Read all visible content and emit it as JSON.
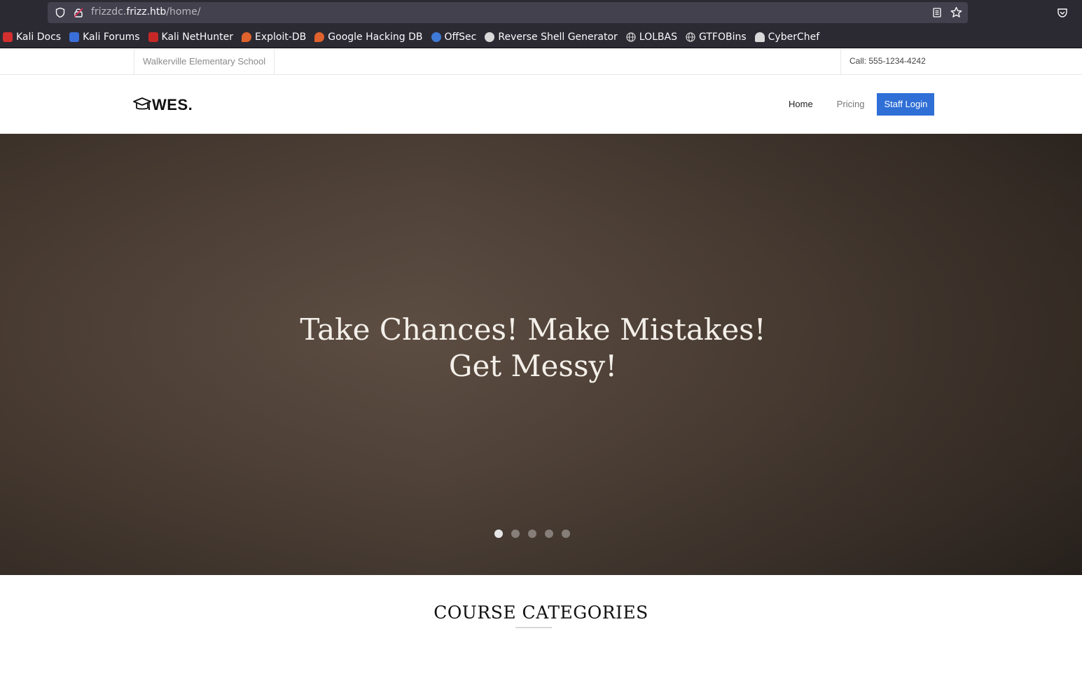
{
  "browser": {
    "url": {
      "prefix": "frizzdc.",
      "host": "frizz.htb",
      "path": "/home/"
    },
    "bookmarks": [
      {
        "label": "Kali Docs",
        "icon": "kali-docs-icon",
        "color": "#d32f2f"
      },
      {
        "label": "Kali Forums",
        "icon": "kali-forums-icon",
        "color": "#3a6ed8"
      },
      {
        "label": "Kali NetHunter",
        "icon": "kali-nethunter-icon",
        "color": "#c62828"
      },
      {
        "label": "Exploit-DB",
        "icon": "exploit-db-icon",
        "color": "#e0622c"
      },
      {
        "label": "Google Hacking DB",
        "icon": "ghdb-icon",
        "color": "#e0622c"
      },
      {
        "label": "OffSec",
        "icon": "offsec-icon",
        "color": "#3f7ad6"
      },
      {
        "label": "Reverse Shell Generator",
        "icon": "skull-icon",
        "color": "#d9d9d9"
      },
      {
        "label": "LOLBAS",
        "icon": "globe-icon",
        "color": "#d9d9d9"
      },
      {
        "label": "GTFOBins",
        "icon": "globe-icon",
        "color": "#d9d9d9"
      },
      {
        "label": "CyberChef",
        "icon": "chef-hat-icon",
        "color": "#d9d9d9"
      }
    ]
  },
  "topbar": {
    "school_name": "Walkerville Elementary School",
    "call": "Call: 555-1234-4242"
  },
  "navbar": {
    "logo_text": "WES.",
    "links": {
      "home": "Home",
      "pricing": "Pricing",
      "staff_login": "Staff Login"
    },
    "accent": "#2f6fd6"
  },
  "hero": {
    "title": "Take Chances! Make Mistakes! Get Messy!",
    "slides": 5,
    "active_slide": 1
  },
  "section": {
    "title": "COURSE CATEGORIES"
  }
}
